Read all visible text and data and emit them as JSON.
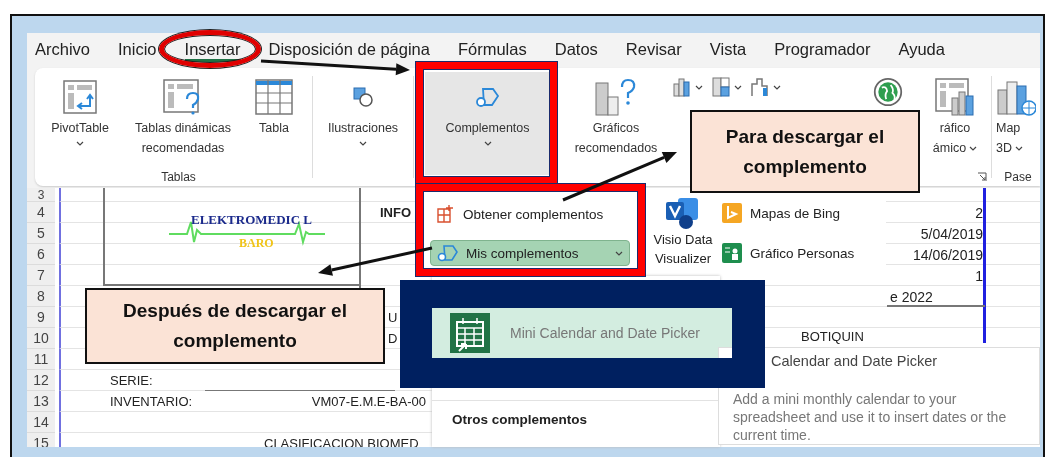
{
  "tabs": [
    {
      "label": "Archivo",
      "selected": false
    },
    {
      "label": "Inicio",
      "selected": false
    },
    {
      "label": "Insertar",
      "selected": true
    },
    {
      "label": "Disposición de página",
      "selected": false
    },
    {
      "label": "Fórmulas",
      "selected": false
    },
    {
      "label": "Datos",
      "selected": false
    },
    {
      "label": "Revisar",
      "selected": false
    },
    {
      "label": "Vista",
      "selected": false
    },
    {
      "label": "Programador",
      "selected": false
    },
    {
      "label": "Ayuda",
      "selected": false
    }
  ],
  "ribbon": {
    "groups": [
      {
        "label": "Tablas",
        "buttons": [
          {
            "kind": "pivot",
            "lines": [
              "PivotTable"
            ],
            "dropdown": true
          },
          {
            "kind": "recpivot",
            "lines": [
              "Tablas dinámicas",
              "recomendadas"
            ],
            "dropdown": false
          },
          {
            "kind": "table",
            "lines": [
              "Tabla"
            ],
            "dropdown": false
          }
        ]
      },
      {
        "buttons": [
          {
            "kind": "shapes",
            "lines": [
              "Ilustraciones"
            ],
            "dropdown": true
          }
        ]
      },
      {
        "buttons": [
          {
            "kind": "addins",
            "lines": [
              "Complementos"
            ],
            "dropdown": true,
            "selected": true
          }
        ]
      },
      {
        "launcher": true,
        "buttons": [
          {
            "kind": "reccharts",
            "lines": [
              "Gráficos",
              "recomendados"
            ],
            "dropdown": false
          },
          {
            "kind": "charticons",
            "dropdown": true
          },
          {
            "kind": "globe",
            "dropdown": false
          },
          {
            "kind": "pivotchart",
            "lines": [
              "ráfico",
              "ámico"
            ],
            "dropdown": true
          }
        ]
      },
      {
        "label": "Pase",
        "buttons": [
          {
            "kind": "map3d",
            "lines": [
              "Map",
              "3D"
            ],
            "dropdown": true
          }
        ]
      }
    ]
  },
  "addins_menu": {
    "items": [
      {
        "kind": "get",
        "label": "Obtener complementos",
        "selected": false
      },
      {
        "kind": "mine",
        "label": "Mis complementos",
        "selected": true,
        "dropdown": true
      }
    ],
    "visio": [
      "Visio Data",
      "Visualizer"
    ],
    "extras": [
      {
        "kind": "bing",
        "label": "Mapas de Bing"
      },
      {
        "kind": "people",
        "label": "Gráfico Personas"
      }
    ]
  },
  "my_addins": {
    "items": [
      {
        "label": "Mini Calendar and Date Picker",
        "selected": true
      }
    ],
    "section": "Otros complementos"
  },
  "tooltip": {
    "title": "Calendar and Date Picker",
    "description": "Add a mini monthly calendar to your spreadsheet and use it to insert dates or the current time."
  },
  "sheet": {
    "logo": {
      "name": "ELEKTROMEDIC L",
      "sub": "BARO"
    },
    "rows": [
      {
        "number": "3"
      },
      {
        "number": "4",
        "cells": [
          {
            "kind": "heading",
            "text": "INFO"
          },
          {
            "kind": "value",
            "text": "2"
          }
        ]
      },
      {
        "number": "5",
        "cells": [
          {
            "kind": "value",
            "text": "5/04/2019"
          }
        ]
      },
      {
        "number": "6",
        "cells": [
          {
            "kind": "value",
            "text": "14/06/2019"
          }
        ]
      },
      {
        "number": "7",
        "cells": [
          {
            "kind": "value",
            "text": "1"
          }
        ]
      },
      {
        "number": "8",
        "cells": [
          {
            "kind": "tail",
            "text": "e 2022"
          }
        ]
      },
      {
        "number": "9",
        "cells": [
          {
            "kind": "cut",
            "text": "U"
          }
        ]
      },
      {
        "number": "10",
        "cells": [
          {
            "kind": "cut",
            "text": "D"
          },
          {
            "kind": "title",
            "text": "BOTIQUIN"
          }
        ]
      },
      {
        "number": "11"
      },
      {
        "number": "12",
        "cells": [
          {
            "kind": "label",
            "text": "SERIE:"
          }
        ]
      },
      {
        "number": "13",
        "cells": [
          {
            "kind": "label",
            "text": "INVENTARIO:"
          },
          {
            "kind": "code",
            "text": "VM07-E.M.E-BA-00"
          }
        ]
      },
      {
        "number": "14"
      },
      {
        "number": "15",
        "cells": [
          {
            "kind": "banner",
            "text": "CLASIFICACION BIOMED"
          }
        ]
      }
    ]
  },
  "callouts": [
    {
      "text": "Para descargar el complemento"
    },
    {
      "text": "Después de descargar el complemento"
    }
  ]
}
